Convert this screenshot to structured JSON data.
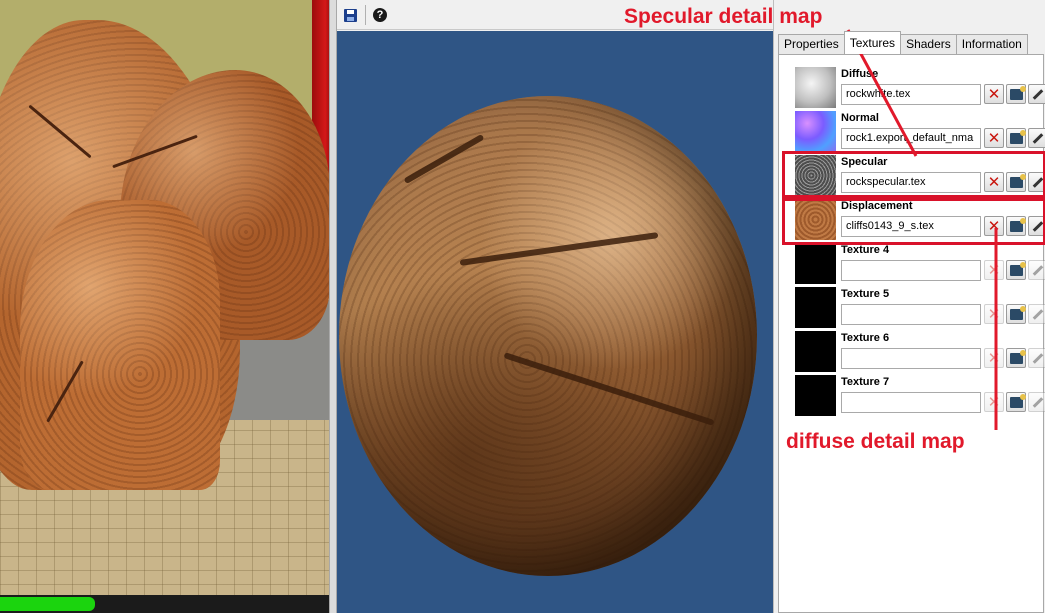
{
  "toolbar": {
    "help_label": "?"
  },
  "tabs": [
    {
      "label": "Properties",
      "active": false
    },
    {
      "label": "Textures",
      "active": true
    },
    {
      "label": "Shaders",
      "active": false
    },
    {
      "label": "Information",
      "active": false
    }
  ],
  "textures": [
    {
      "label": "Diffuse",
      "value": "rockwhite.tex",
      "thumb": "diffuse",
      "buttons_enabled": true
    },
    {
      "label": "Normal",
      "value": "rock1.export_default_nma",
      "thumb": "normal",
      "buttons_enabled": true
    },
    {
      "label": "Specular",
      "value": "rockspecular.tex",
      "thumb": "specular",
      "buttons_enabled": true
    },
    {
      "label": "Displacement",
      "value": "cliffs0143_9_s.tex",
      "thumb": "displacement",
      "buttons_enabled": true
    },
    {
      "label": "Texture 4",
      "value": "",
      "thumb": "empty",
      "buttons_enabled": false
    },
    {
      "label": "Texture 5",
      "value": "",
      "thumb": "empty",
      "buttons_enabled": false
    },
    {
      "label": "Texture 6",
      "value": "",
      "thumb": "empty",
      "buttons_enabled": false
    },
    {
      "label": "Texture 7",
      "value": "",
      "thumb": "empty",
      "buttons_enabled": false
    }
  ],
  "annotations": {
    "specular": "Specular detail map",
    "diffuse": "diffuse detail map",
    "color": "#e1192b"
  },
  "icons": {
    "save": "save-icon",
    "help": "help-icon",
    "clear": "clear-icon",
    "browse": "browse-icon",
    "edit": "edit-icon"
  },
  "colors": {
    "preview_background": "#2f5585",
    "highlight": "#d9122a"
  }
}
